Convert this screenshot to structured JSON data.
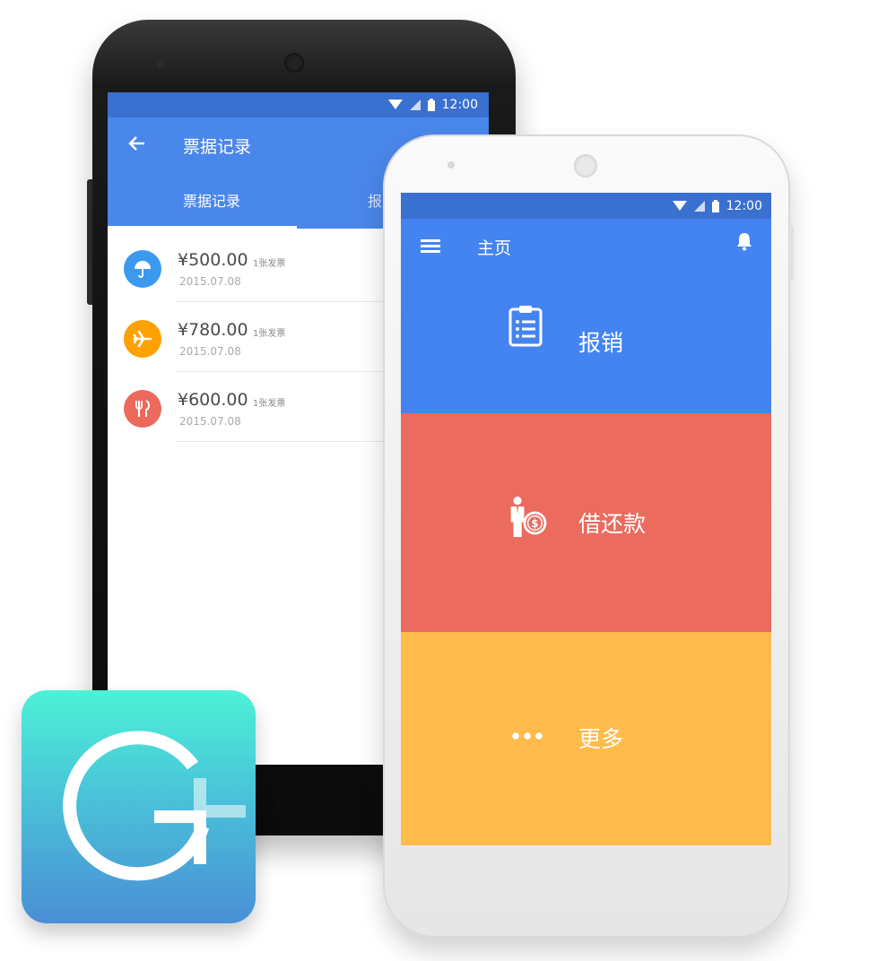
{
  "back_phone": {
    "status": {
      "time": "12:00",
      "wifi_icon": "wifi-icon",
      "signal_icon": "signal-icon",
      "battery_icon": "battery-icon"
    },
    "header": {
      "back_icon": "arrow-left-icon",
      "title": "票据记录"
    },
    "tabs": [
      {
        "label": "票据记录",
        "active": true
      },
      {
        "label": "报",
        "active": false
      }
    ],
    "tickets": [
      {
        "icon": "umbrella-icon",
        "color": "#3c99f0",
        "amount": "¥500.00",
        "count": "1张发票",
        "date": "2015.07.08"
      },
      {
        "icon": "airplane-icon",
        "color": "#ffa101",
        "amount": "¥780.00",
        "count": "1张发票",
        "date": "2015.07.08"
      },
      {
        "icon": "utensils-icon",
        "color": "#eb6a5b",
        "amount": "¥600.00",
        "count": "1张发票",
        "date": "2015.07.08"
      }
    ]
  },
  "front_phone": {
    "status": {
      "time": "12:00",
      "wifi_icon": "wifi-icon",
      "signal_icon": "signal-icon",
      "battery_icon": "battery-icon"
    },
    "header": {
      "menu_icon": "menu-icon",
      "title": "主页",
      "bell_icon": "bell-icon"
    },
    "tiles": [
      {
        "icon": "clipboard-icon",
        "label": "报销",
        "color": "#4484f0"
      },
      {
        "icon": "person-money-icon",
        "label": "借还款",
        "color": "#eb6b5e"
      },
      {
        "icon": "more-dots-icon",
        "label": "更多",
        "color": "#ffbb4c"
      }
    ]
  },
  "logo": {
    "icon": "g-plus-logo-icon"
  }
}
